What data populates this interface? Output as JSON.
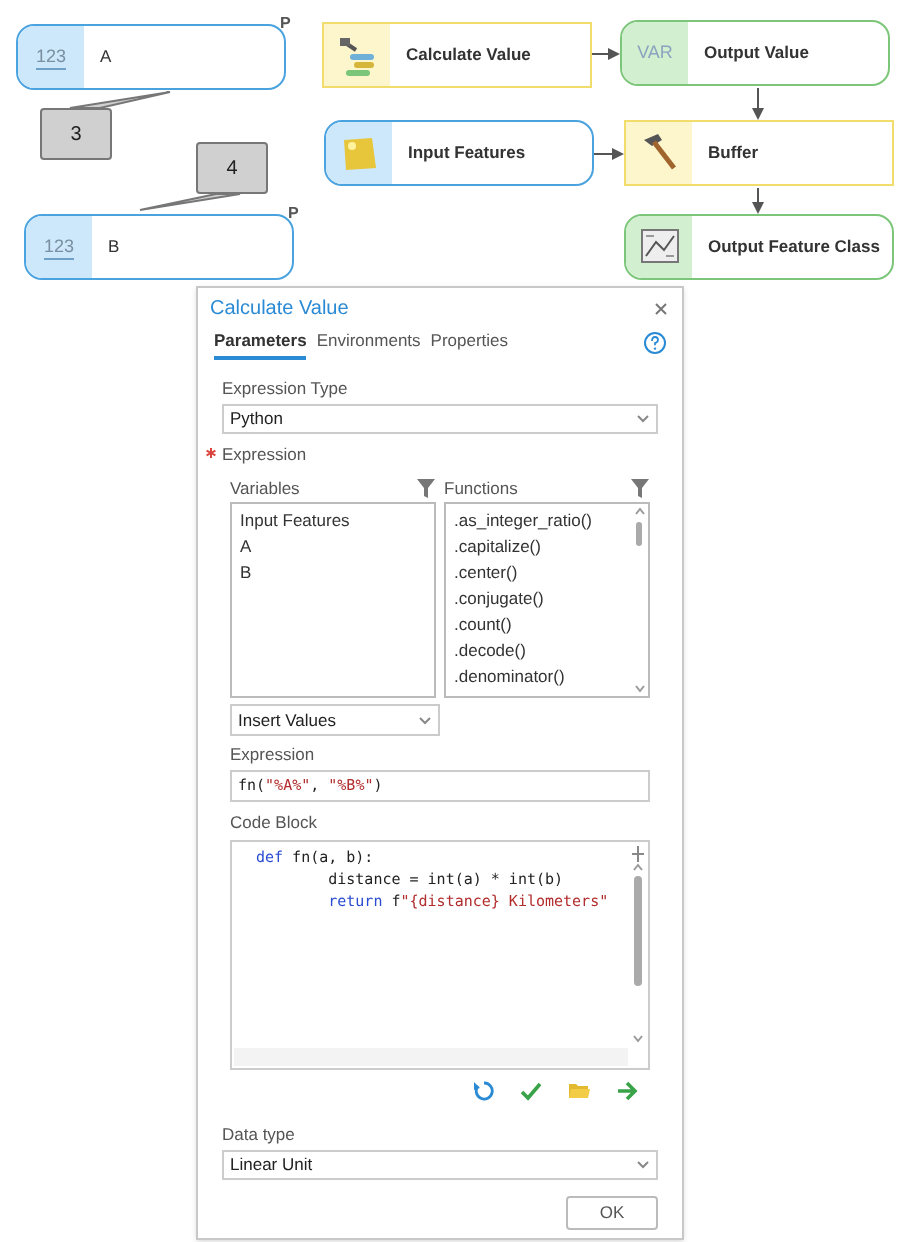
{
  "diagram": {
    "nodes": [
      {
        "kind": "variable",
        "label": "A",
        "icon_text": "123",
        "parameter_mark": "P"
      },
      {
        "kind": "variable",
        "label": "B",
        "icon_text": "123",
        "parameter_mark": "P"
      },
      {
        "kind": "tool",
        "label": "Calculate Value"
      },
      {
        "kind": "output",
        "label": "Output Value",
        "icon_text": "VAR"
      },
      {
        "kind": "data",
        "label": "Input Features"
      },
      {
        "kind": "tool",
        "label": "Buffer"
      },
      {
        "kind": "output",
        "label": "Output Feature Class"
      }
    ],
    "callouts": [
      {
        "label": "3"
      },
      {
        "label": "4"
      }
    ]
  },
  "dialog": {
    "title": "Calculate Value",
    "tabs": [
      {
        "label": "Parameters",
        "selected": true
      },
      {
        "label": "Environments",
        "selected": false
      },
      {
        "label": "Properties",
        "selected": false
      }
    ],
    "expression_type": {
      "label": "Expression Type",
      "value": "Python"
    },
    "expression_section": {
      "label": "Expression",
      "required": true
    },
    "variables": {
      "label": "Variables",
      "items": [
        "Input Features",
        "A",
        "B"
      ]
    },
    "functions": {
      "label": "Functions",
      "items": [
        ".as_integer_ratio()",
        ".capitalize()",
        ".center()",
        ".conjugate()",
        ".count()",
        ".decode()",
        ".denominator()"
      ]
    },
    "insert_values": {
      "value": "Insert Values"
    },
    "expression": {
      "label": "Expression",
      "tokens": [
        {
          "text": "fn(",
          "kind": "plain"
        },
        {
          "text": "\"%A%\"",
          "kind": "string"
        },
        {
          "text": ", ",
          "kind": "plain"
        },
        {
          "text": "\"%B%\"",
          "kind": "string"
        },
        {
          "text": ")",
          "kind": "plain"
        }
      ]
    },
    "code_block": {
      "label": "Code Block",
      "lines": [
        [
          {
            "text": "def",
            "kind": "keyword"
          },
          {
            "text": " fn(a, b):",
            "kind": "plain"
          }
        ],
        [
          {
            "text": "        distance = int(a) * int(b)",
            "kind": "plain"
          }
        ],
        [
          {
            "text": "        return",
            "kind": "keyword"
          },
          {
            "text": " f",
            "kind": "plain"
          },
          {
            "text": "\"{distance} Kilometers\"",
            "kind": "string"
          }
        ]
      ]
    },
    "data_type": {
      "label": "Data type",
      "value": "Linear Unit"
    },
    "ok_button": "OK"
  }
}
